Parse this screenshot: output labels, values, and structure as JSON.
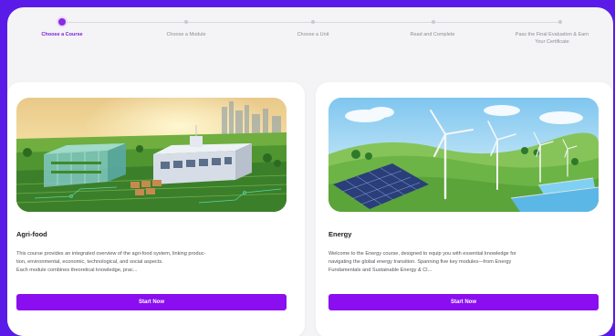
{
  "stepper": {
    "steps": [
      {
        "label_lines": [
          "Choose a Course"
        ],
        "active": true
      },
      {
        "label_lines": [
          "Choose a Module"
        ],
        "active": false
      },
      {
        "label_lines": [
          "Choose a Unit"
        ],
        "active": false
      },
      {
        "label_lines": [
          "Read and Complete"
        ],
        "active": false
      },
      {
        "label_lines": [
          "Pass the Final Evaluation & Earn",
          "Your Certificate"
        ],
        "active": false
      }
    ]
  },
  "courses": [
    {
      "title": "Agri-food",
      "description_lines": [
        "This course provides an integrated overview of the agri-food system, linking produc-",
        "tion, environmental, economic, technological, and social aspects.",
        "Each module combines theoretical knowledge, prac..."
      ],
      "button_label": "Start Now"
    },
    {
      "title": "Energy",
      "description_lines": [
        "Welcome to the Energy course, designed to equip you with essential knowledge for",
        "navigating the global energy transition. Spanning five key modules—from Energy",
        "Fundamentals and Sustainable Energy & Cl..."
      ],
      "button_label": "Start Now"
    }
  ],
  "colors": {
    "accent": "#8a0ef0",
    "background": "#5a1be8",
    "panel": "#f4f4f6"
  }
}
